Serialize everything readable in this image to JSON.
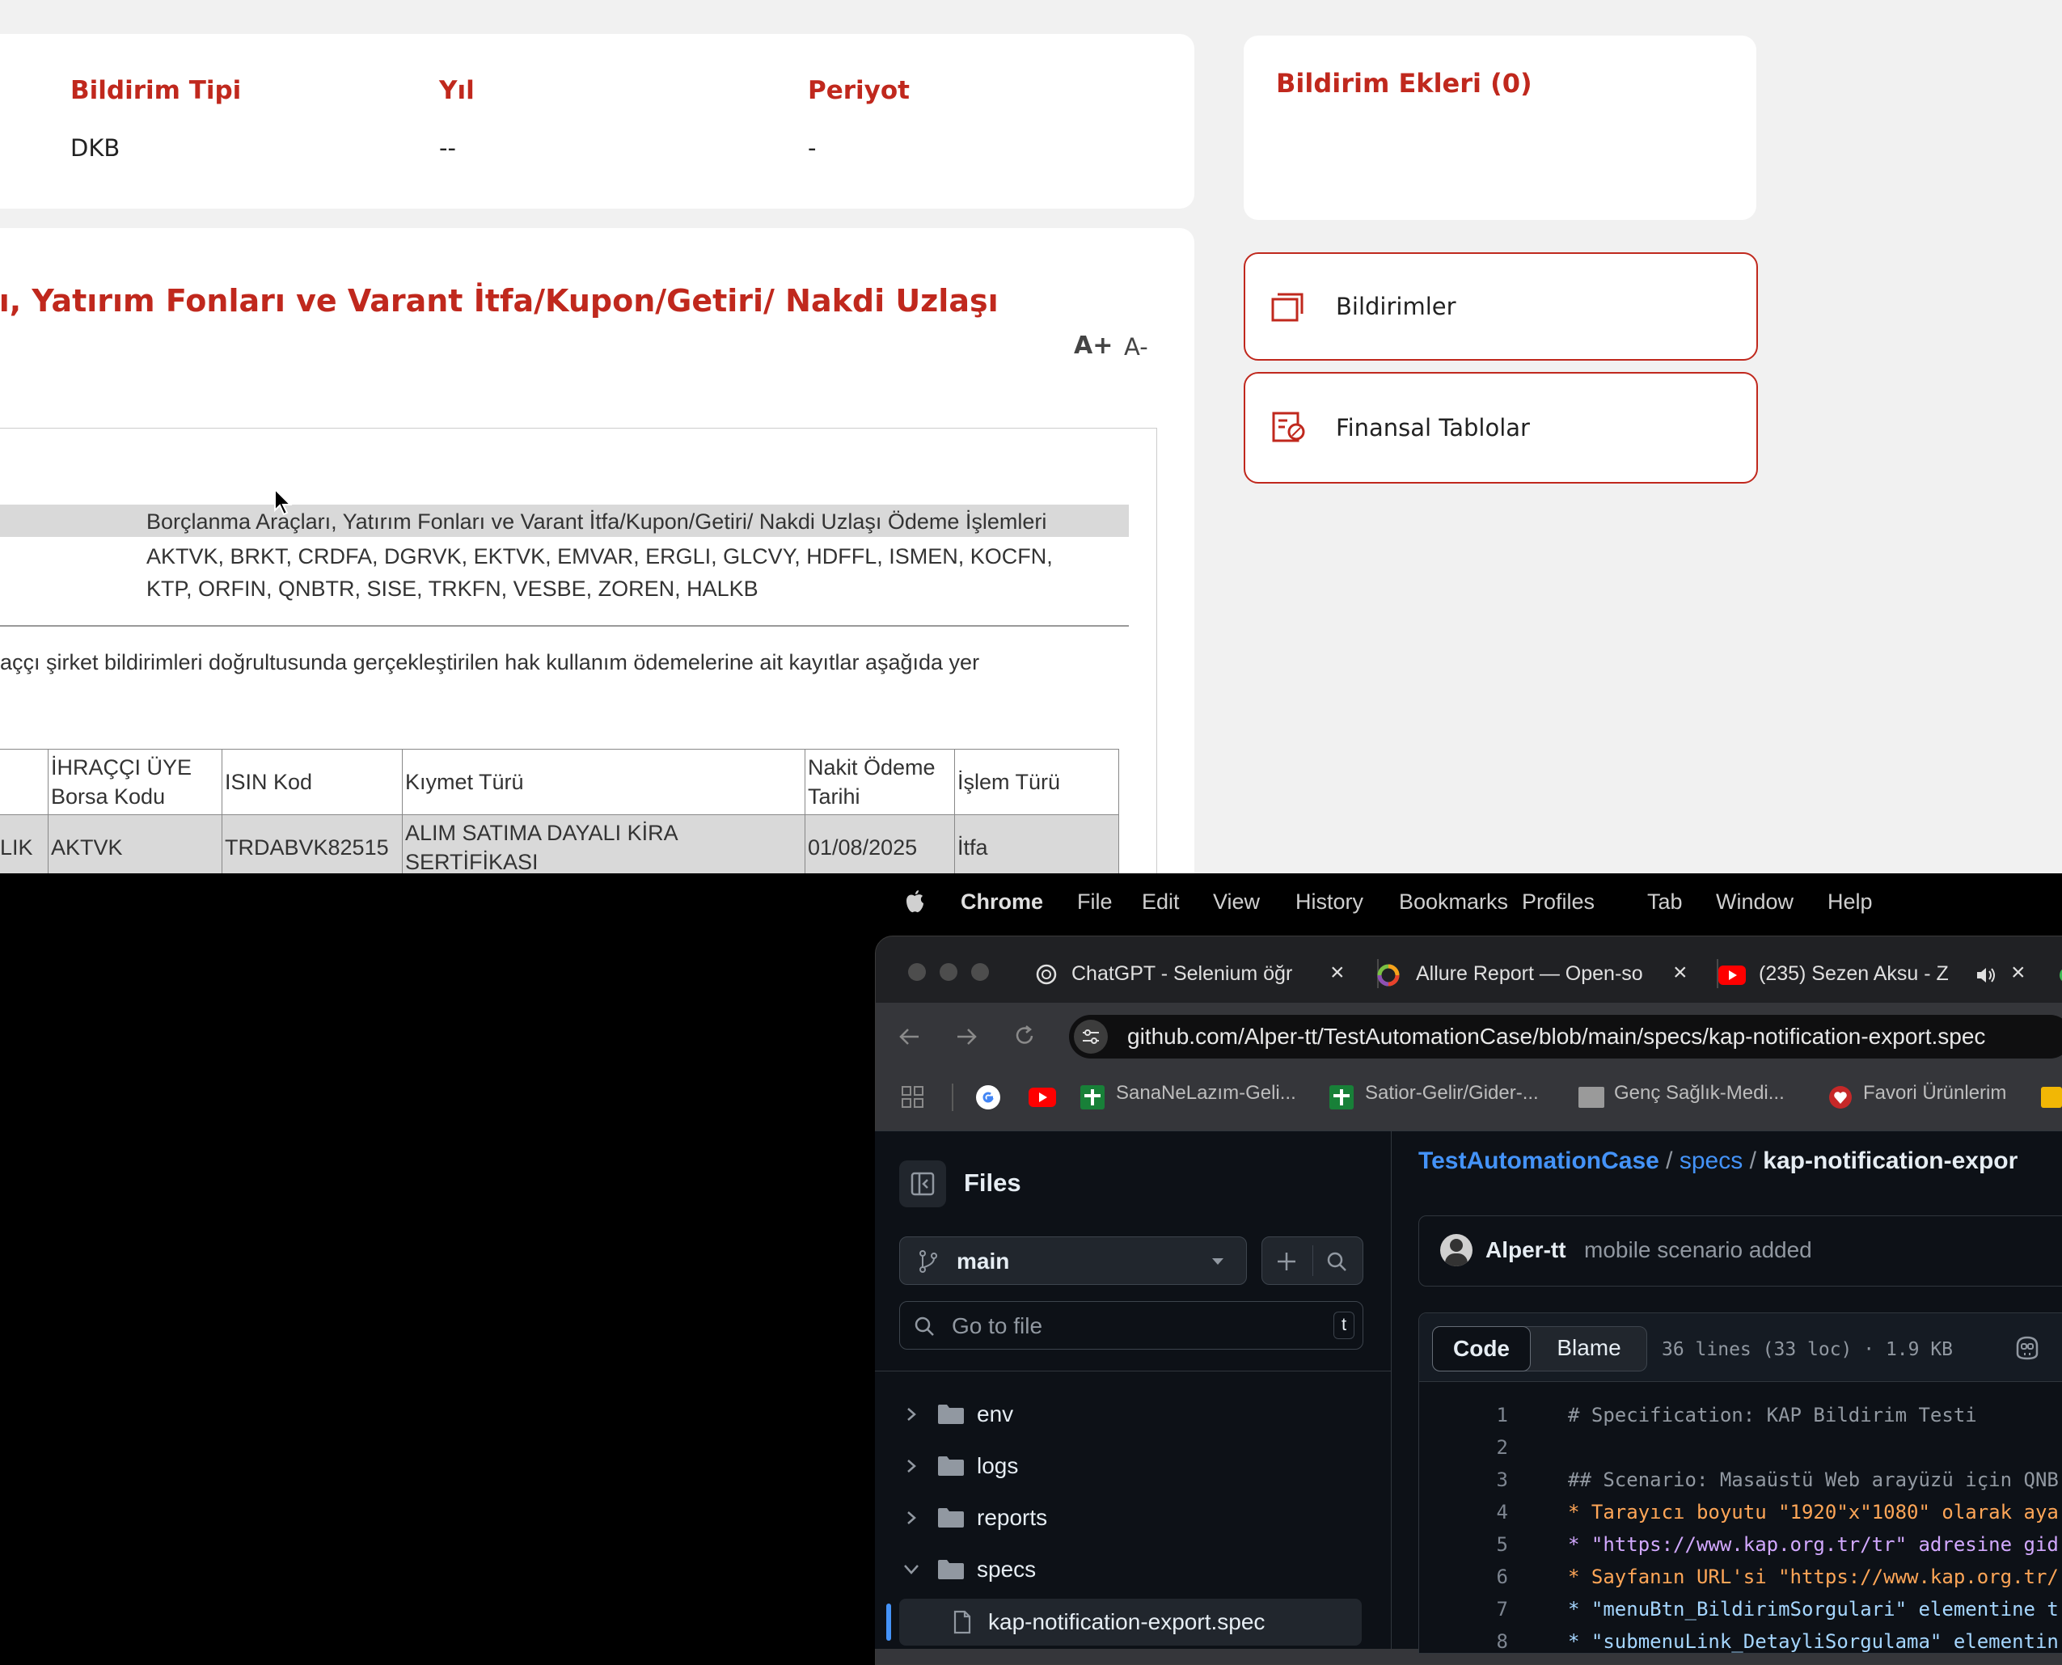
{
  "top_page": {
    "info": {
      "col1": {
        "header": "Bildirim Tipi",
        "value": "DKB"
      },
      "col2": {
        "header": "Yıl",
        "value": "--"
      },
      "col3": {
        "header": "Periyot",
        "value": "-"
      }
    },
    "attachments_title": "Bildirim Ekleri (0)",
    "side_buttons": [
      {
        "label": "Bildirimler"
      },
      {
        "label": "Finansal Tablolar"
      }
    ],
    "notification_title": "rı, Yatırım Fonları ve Varant İtfa/Kupon/Getiri/ Nakdi Uzlaşı",
    "font_plus": "A+",
    "font_minus": "A-",
    "doc": {
      "subject": "Borçlanma Araçları, Yatırım Fonları ve Varant İtfa/Kupon/Getiri/ Nakdi Uzlaşı Ödeme İşlemleri",
      "codes_line1": "AKTVK, BRKT, CRDFA, DGRVK, EKTVK, EMVAR, ERGLI, GLCVY, HDFFL, ISMEN, KOCFN,",
      "codes_line2": "KTP, ORFIN, QNBTR, SISE, TRKFN, VESBE, ZOREN, HALKB",
      "paragraph": "aççı şirket bildirimleri doğrultusunda gerçekleştirilen hak kullanım ödemelerine ait kayıtlar aşağıda yer",
      "table": {
        "headers": [
          "",
          "İHRAÇÇI ÜYE Borsa Kodu",
          "ISIN Kod",
          "Kıymet Türü",
          "Nakit Ödeme Tarihi",
          "İşlem Türü"
        ],
        "rows": [
          [
            "LIK",
            "AKTVK",
            "TRDABVK82515",
            "ALIM SATIMA DAYALI KİRA SERTİFİKASI",
            "01/08/2025",
            "İtfa"
          ]
        ]
      }
    }
  },
  "menubar": {
    "app": "Chrome",
    "items": [
      "File",
      "Edit",
      "View",
      "History",
      "Bookmarks",
      "Profiles",
      "Tab",
      "Window",
      "Help"
    ]
  },
  "browser": {
    "tabs": [
      {
        "title": "ChatGPT - Selenium öğr"
      },
      {
        "title": "Allure Report — Open-so"
      },
      {
        "title": "(235) Sezen Aksu - Z"
      }
    ],
    "url": "github.com/Alper-tt/TestAutomationCase/blob/main/specs/kap-notification-export.spec",
    "bookmarks": [
      "SanaNeLazım-Geli...",
      "Satior-Gelir/Gider-...",
      "Genç Sağlık-Medi...",
      "Favori Ürünlerim"
    ]
  },
  "github": {
    "files_title": "Files",
    "branch": "main",
    "go_to_file_placeholder": "Go to file",
    "shortcut_key": "t",
    "tree": [
      {
        "name": "env",
        "type": "folder",
        "expanded": false
      },
      {
        "name": "logs",
        "type": "folder",
        "expanded": false
      },
      {
        "name": "reports",
        "type": "folder",
        "expanded": false
      },
      {
        "name": "specs",
        "type": "folder",
        "expanded": true
      },
      {
        "name": "kap-notification-export.spec",
        "type": "file",
        "selected": true
      }
    ],
    "breadcrumb": {
      "repo": "TestAutomationCase",
      "sep1": "/",
      "folder": "specs",
      "sep2": "/",
      "file": "kap-notification-expor"
    },
    "commit": {
      "author": "Alper-tt",
      "message": "mobile scenario added"
    },
    "view_tabs": {
      "code": "Code",
      "blame": "Blame"
    },
    "file_info": "36 lines (33 loc) · 1.9 KB",
    "code_lines": [
      {
        "n": "1",
        "text": "# Specification: KAP Bildirim Testi"
      },
      {
        "n": "2",
        "text": ""
      },
      {
        "n": "3",
        "text": "## Scenario: Masaüstü Web arayüzü için QNB"
      },
      {
        "n": "4",
        "text": "* Tarayıcı boyutu \"1920\"x\"1080\" olarak aya"
      },
      {
        "n": "5",
        "text": "* \"https://www.kap.org.tr/tr\" adresine gid"
      },
      {
        "n": "6",
        "text": "* Sayfanın URL'si \"https://www.kap.org.tr/"
      },
      {
        "n": "7",
        "text": "* \"menuBtn_BildirimSorgulari\" elementine t"
      },
      {
        "n": "8",
        "text": "* \"submenuLink_DetayliSorgulama\" elementin"
      }
    ]
  }
}
